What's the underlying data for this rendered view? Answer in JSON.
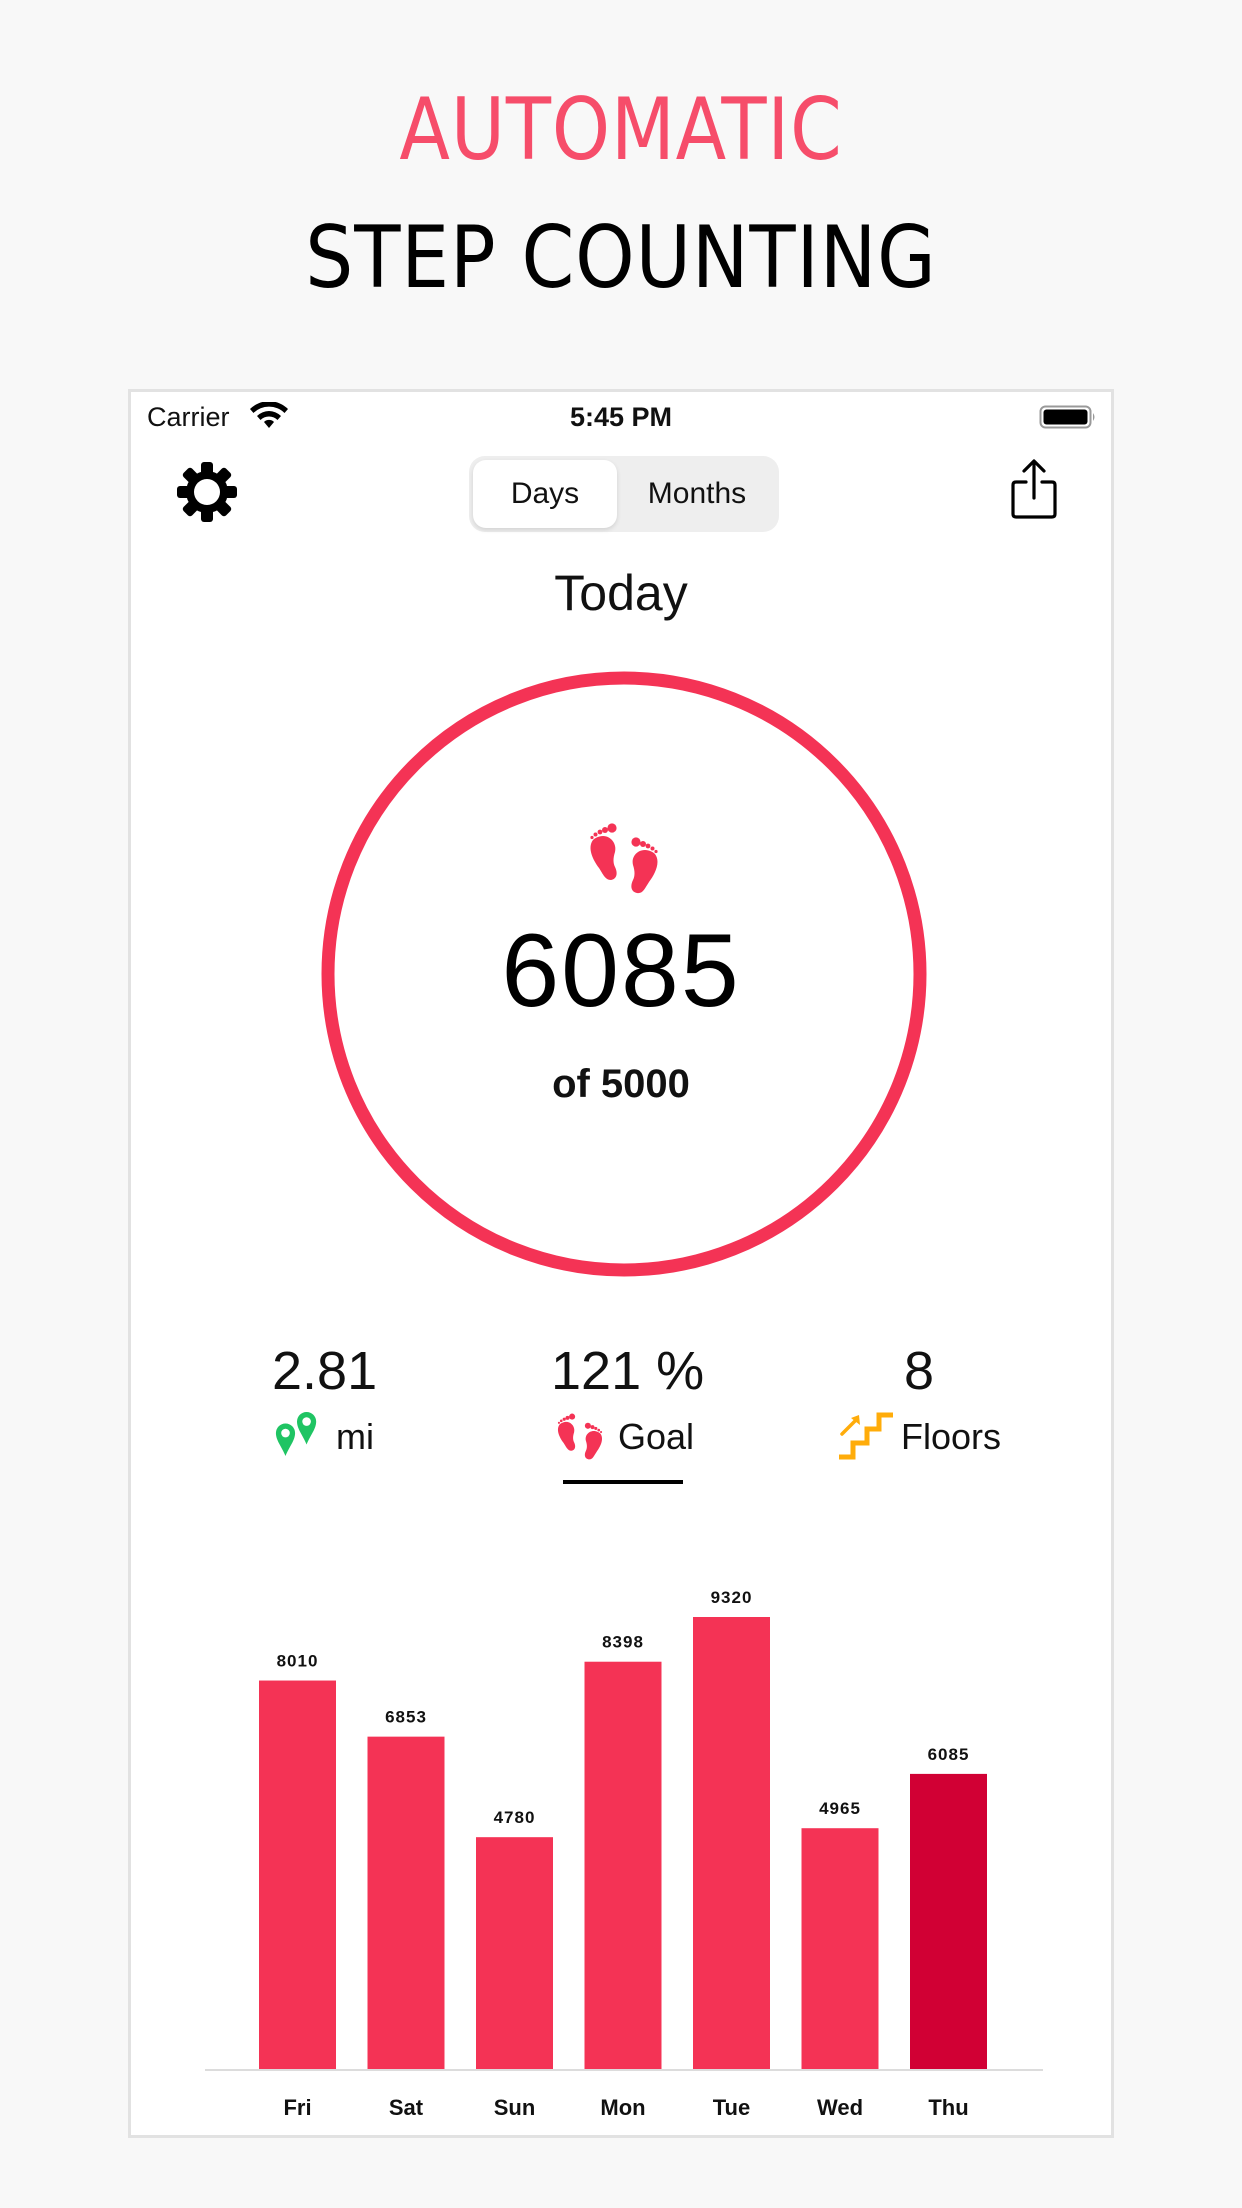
{
  "promo": {
    "headline_accent": "AUTOMATIC",
    "headline_main": "STEP COUNTING",
    "accent_color": "#f64d6a"
  },
  "status_bar": {
    "carrier": "Carrier",
    "time": "5:45 PM",
    "wifi_icon": "wifi-icon",
    "battery_icon": "battery-full-icon"
  },
  "toolbar": {
    "settings_icon": "gear-icon",
    "share_icon": "share-icon",
    "segments": [
      {
        "label": "Days",
        "selected": true
      },
      {
        "label": "Months",
        "selected": false
      }
    ]
  },
  "today": {
    "title": "Today",
    "steps": "6085",
    "goal_text": "of 5000",
    "progress_percent": 121,
    "ring_color": "#f43355",
    "icon": "footprints-icon"
  },
  "stats": [
    {
      "id": "distance",
      "value": "2.81",
      "label": "mi",
      "icon": "map-pins-icon",
      "icon_color": "#1fc463",
      "selected": false
    },
    {
      "id": "goal",
      "value": "121 %",
      "label": "Goal",
      "icon": "footprints-icon",
      "icon_color": "#f43355",
      "selected": true
    },
    {
      "id": "floors",
      "value": "8",
      "label": "Floors",
      "icon": "stairs-icon",
      "icon_color": "#ffac0a",
      "selected": false
    }
  ],
  "chart_data": {
    "type": "bar",
    "title": "",
    "xlabel": "",
    "ylabel": "",
    "categories": [
      "Fri",
      "Sat",
      "Sun",
      "Mon",
      "Tue",
      "Wed",
      "Thu"
    ],
    "values": [
      8010,
      6853,
      4780,
      8398,
      9320,
      4965,
      6085
    ],
    "value_labels": [
      "8010",
      "6853",
      "4780",
      "8398",
      "9320",
      "4965",
      "6085"
    ],
    "highlight_index": 6,
    "bar_color": "#f43355",
    "highlight_color": "#d10034",
    "ylim": [
      0,
      9320
    ],
    "grid": false,
    "legend": "none"
  }
}
